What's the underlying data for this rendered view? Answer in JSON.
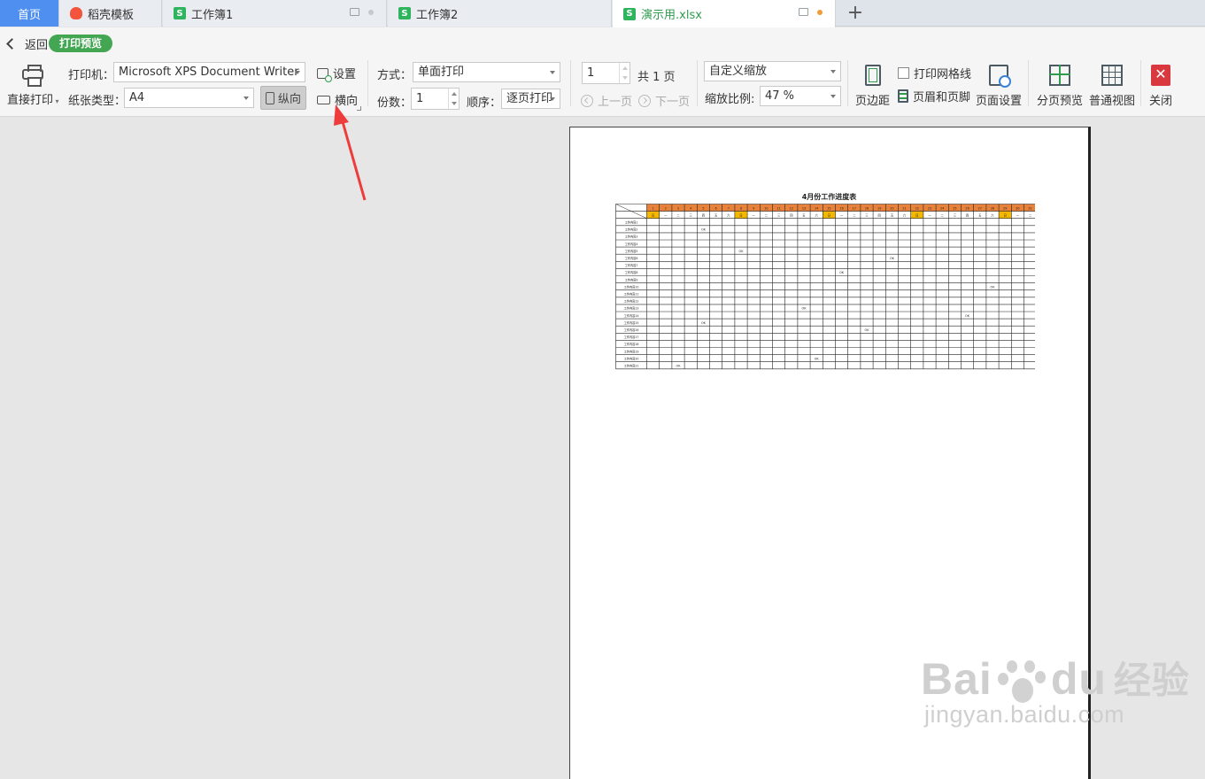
{
  "tabs": [
    {
      "label": "首页"
    },
    {
      "label": "稻壳模板"
    },
    {
      "label": "工作簿1"
    },
    {
      "label": "工作簿2"
    },
    {
      "label": "演示用.xlsx"
    }
  ],
  "toolbar": {
    "back_label": "返回",
    "mode_label": "打印预览",
    "direct_print_label": "直接打印",
    "printer_label": "打印机：",
    "printer_value": "Microsoft XPS Document Writer",
    "paper_label": "纸张类型：",
    "paper_value": "A4",
    "portrait_label": "纵向",
    "settings_label": "设置",
    "landscape_label": "横向",
    "method_label": "方式：",
    "method_value": "单面打印",
    "copies_label": "份数：",
    "copies_value": "1",
    "order_label": "顺序：",
    "order_value": "逐页打印",
    "page_value": "1",
    "total_pages": "共 1 页",
    "prev_page": "上一页",
    "next_page": "下一页",
    "scale_mode": "自定义缩放",
    "scale_label": "缩放比例:",
    "scale_value": "47 %",
    "margins_label": "页边距",
    "gridlines_label": "打印网格线",
    "header_footer_label": "页眉和页脚",
    "page_setup_label": "页面设置",
    "page_break_label": "分页预览",
    "normal_view_label": "普通视图",
    "close_label": "关闭"
  },
  "sheet": {
    "title": "4月份工作进度表",
    "days": [
      "1",
      "2",
      "3",
      "4",
      "5",
      "6",
      "7",
      "8",
      "9",
      "10",
      "11",
      "12",
      "13",
      "14",
      "15",
      "16",
      "17",
      "18",
      "19",
      "20",
      "21",
      "22",
      "23",
      "24",
      "25",
      "26",
      "27",
      "28",
      "29",
      "30",
      "31"
    ],
    "weekdays": [
      "日",
      "一",
      "二",
      "三",
      "四",
      "五",
      "六",
      "日",
      "一",
      "二",
      "三",
      "四",
      "五",
      "六",
      "日",
      "一",
      "二",
      "三",
      "四",
      "五",
      "六",
      "日",
      "一",
      "二",
      "三",
      "四",
      "五",
      "六",
      "日",
      "一",
      "二"
    ],
    "rows": [
      "工作内容1",
      "工作内容2",
      "工作内容3",
      "工作内容4",
      "工作内容5",
      "工作内容6",
      "工作内容7",
      "工作内容8",
      "工作内容9",
      "工作内容10",
      "工作内容11",
      "工作内容12",
      "工作内容13",
      "工作内容14",
      "工作内容15",
      "工作内容16",
      "工作内容17",
      "工作内容18",
      "工作内容19",
      "工作内容20",
      "工作内容21"
    ],
    "marks": [
      {
        "row": 2,
        "day": 5,
        "text": "OK"
      },
      {
        "row": 5,
        "day": 8,
        "text": "OK"
      },
      {
        "row": 6,
        "day": 20,
        "text": "OK"
      },
      {
        "row": 8,
        "day": 16,
        "text": "OK"
      },
      {
        "row": 10,
        "day": 28,
        "text": "OK"
      },
      {
        "row": 13,
        "day": 13,
        "text": "OK"
      },
      {
        "row": 14,
        "day": 26,
        "text": "OK"
      },
      {
        "row": 15,
        "day": 5,
        "text": "OK"
      },
      {
        "row": 16,
        "day": 18,
        "text": "OK"
      },
      {
        "row": 20,
        "day": 14,
        "text": "OK"
      },
      {
        "row": 21,
        "day": 3,
        "text": "OK"
      }
    ],
    "header_color": "#e8823a",
    "weekend_color": "#f5b800"
  },
  "watermark": {
    "brand_left": "Bai",
    "brand_right": "du",
    "brand_cn": "经验",
    "url": "jingyan.baidu.com"
  }
}
